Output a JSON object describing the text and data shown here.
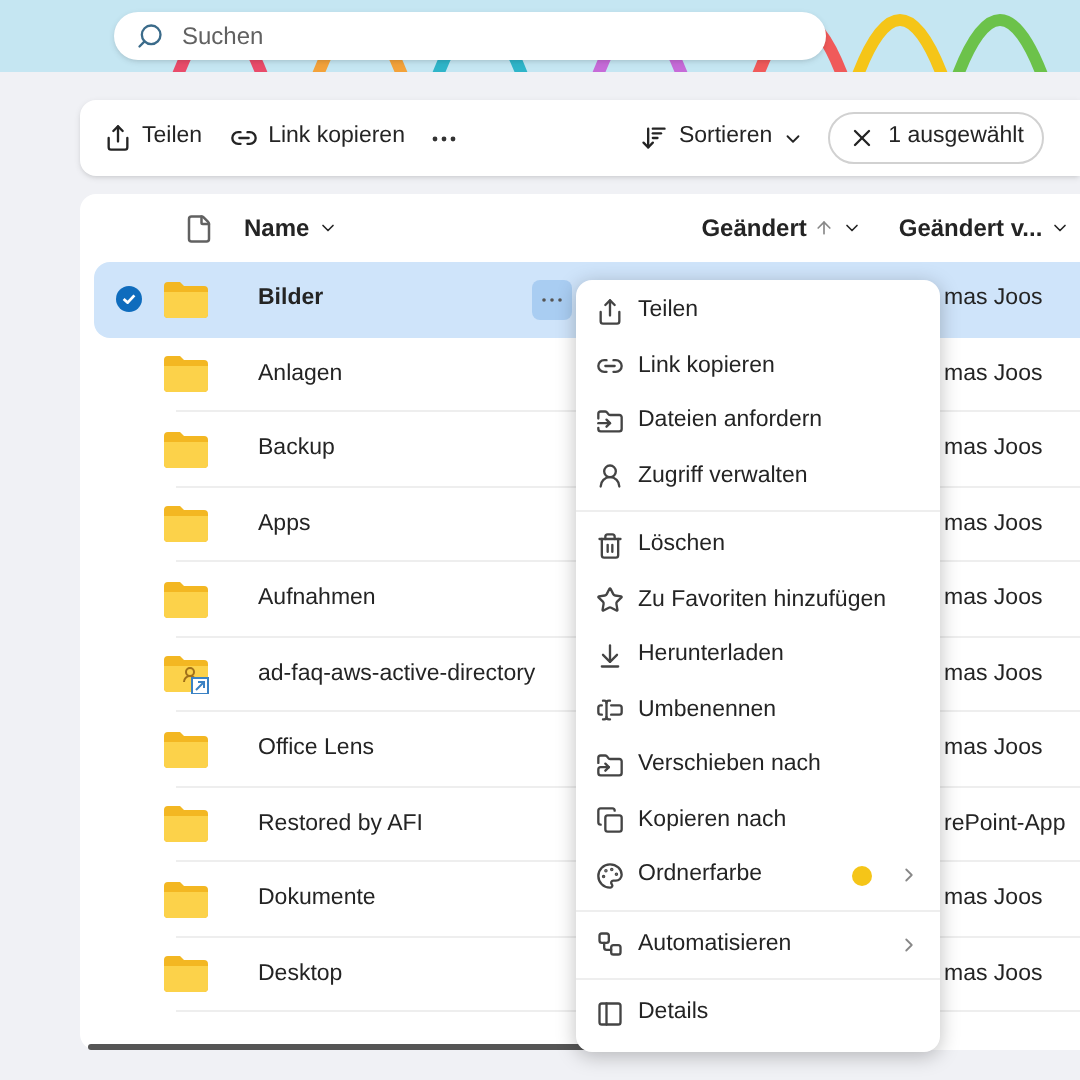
{
  "search": {
    "placeholder": "Suchen"
  },
  "toolbar": {
    "share": "Teilen",
    "copy_link": "Link kopieren",
    "sort": "Sortieren",
    "selection": "1 ausgewählt"
  },
  "columns": {
    "name": "Name",
    "modified": "Geändert",
    "modified_by": "Geändert v..."
  },
  "rows": [
    {
      "name": "Bilder",
      "kind": "folder",
      "selected": true,
      "modified_by": "mas Joos"
    },
    {
      "name": "Anlagen",
      "kind": "folder",
      "selected": false,
      "modified_by": "mas Joos"
    },
    {
      "name": "Backup",
      "kind": "folder",
      "selected": false,
      "modified_by": "mas Joos"
    },
    {
      "name": "Apps",
      "kind": "folder",
      "selected": false,
      "modified_by": "mas Joos"
    },
    {
      "name": "Aufnahmen",
      "kind": "folder",
      "selected": false,
      "modified_by": "mas Joos"
    },
    {
      "name": "ad-faq-aws-active-directory",
      "kind": "shared",
      "selected": false,
      "modified_by": "mas Joos"
    },
    {
      "name": "Office Lens",
      "kind": "folder",
      "selected": false,
      "modified_by": "mas Joos"
    },
    {
      "name": "Restored by AFI",
      "kind": "folder",
      "selected": false,
      "modified_by": "rePoint-App"
    },
    {
      "name": "Dokumente",
      "kind": "folder",
      "selected": false,
      "modified_by": "mas Joos"
    },
    {
      "name": "Desktop",
      "kind": "folder",
      "selected": false,
      "modified_by": "mas Joos"
    }
  ],
  "context_menu": {
    "groups": [
      [
        {
          "label": "Teilen",
          "submenu": false
        },
        {
          "label": "Link kopieren",
          "submenu": false
        },
        {
          "label": "Dateien anfordern",
          "submenu": false
        },
        {
          "label": "Zugriff verwalten",
          "submenu": false
        }
      ],
      [
        {
          "label": "Löschen",
          "submenu": false
        },
        {
          "label": "Zu Favoriten hinzufügen",
          "submenu": false
        },
        {
          "label": "Herunterladen",
          "submenu": false
        },
        {
          "label": "Umbenennen",
          "submenu": false
        },
        {
          "label": "Verschieben nach",
          "submenu": false
        },
        {
          "label": "Kopieren nach",
          "submenu": false
        },
        {
          "label": "Ordnerfarbe",
          "submenu": true,
          "color": "#f5c518"
        }
      ],
      [
        {
          "label": "Automatisieren",
          "submenu": true
        }
      ],
      [
        {
          "label": "Details",
          "submenu": false
        }
      ]
    ]
  }
}
